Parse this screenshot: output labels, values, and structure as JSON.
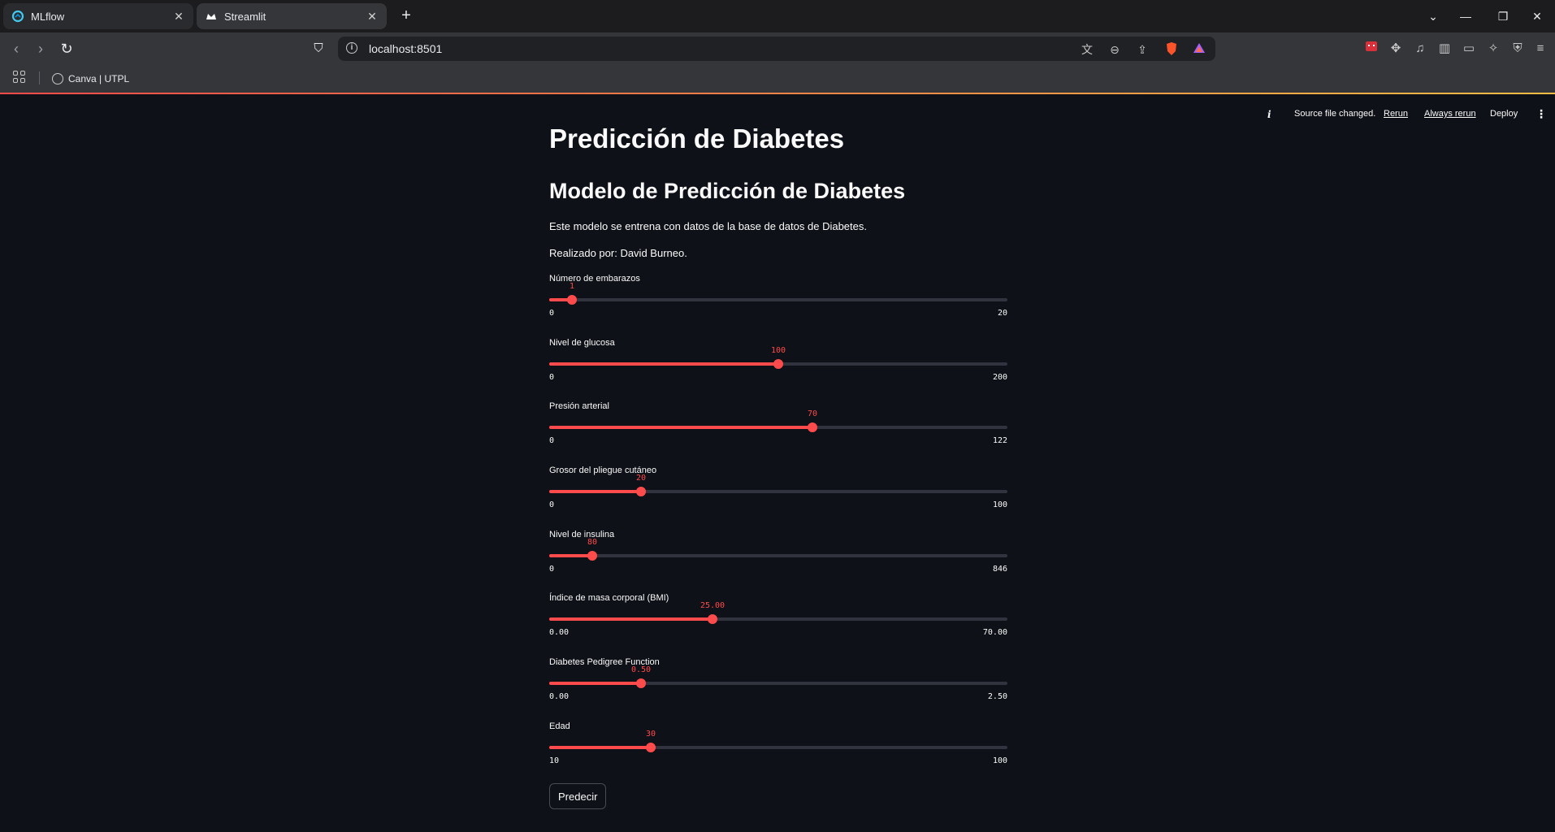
{
  "browser": {
    "tabs": [
      {
        "title": "MLflow",
        "icon": "mlflow-icon",
        "active": false
      },
      {
        "title": "Streamlit",
        "icon": "streamlit-crown-icon",
        "active": true
      }
    ],
    "url": "localhost:8501",
    "bookmarks": [
      {
        "label": "Canva | UTPL",
        "icon": "globe-icon"
      }
    ]
  },
  "st_header": {
    "status": "Source file changed.",
    "rerun": "Rerun",
    "always_rerun": "Always rerun",
    "deploy": "Deploy",
    "accent": "#ff4b4b"
  },
  "app": {
    "title": "Predicción de Diabetes",
    "subtitle": "Modelo de Predicción de Diabetes",
    "description": "Este modelo se entrena con datos de la base de datos de Diabetes.",
    "author": "Realizado por: David Burneo.",
    "sliders": [
      {
        "label": "Número de embarazos",
        "value": "1",
        "min": "0",
        "max": "20",
        "fraction": 0.05
      },
      {
        "label": "Nivel de glucosa",
        "value": "100",
        "min": "0",
        "max": "200",
        "fraction": 0.5
      },
      {
        "label": "Presión arterial",
        "value": "70",
        "min": "0",
        "max": "122",
        "fraction": 0.5738
      },
      {
        "label": "Grosor del pliegue cutáneo",
        "value": "20",
        "min": "0",
        "max": "100",
        "fraction": 0.2
      },
      {
        "label": "Nivel de insulina",
        "value": "80",
        "min": "0",
        "max": "846",
        "fraction": 0.0946
      },
      {
        "label": "Índice de masa corporal (BMI)",
        "value": "25.00",
        "min": "0.00",
        "max": "70.00",
        "fraction": 0.3571
      },
      {
        "label": "Diabetes Pedigree Function",
        "value": "0.50",
        "min": "0.00",
        "max": "2.50",
        "fraction": 0.2
      },
      {
        "label": "Edad",
        "value": "30",
        "min": "10",
        "max": "100",
        "fraction": 0.2222
      }
    ],
    "predict_button": "Predecir"
  }
}
